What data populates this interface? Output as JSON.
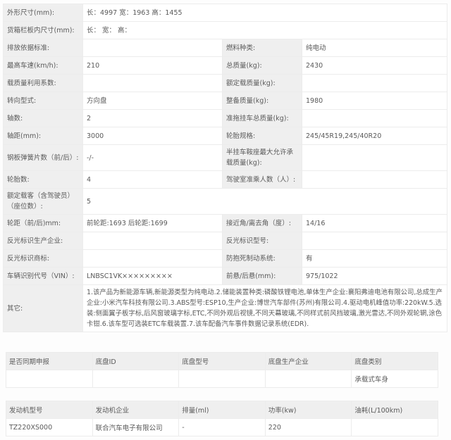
{
  "spec": {
    "dimensions": {
      "label": "外形尺寸(mm):",
      "value": "长：4997 宽：1963 高：1455"
    },
    "cargo_dims": {
      "label": "货箱栏板内尺寸(mm):",
      "value": "长：  宽：  高："
    },
    "emission_std": {
      "label": "排放依据标准:",
      "value": ""
    },
    "fuel_type": {
      "label": "燃料种类:",
      "value": "纯电动"
    },
    "max_speed": {
      "label": "最高车速(km/h):",
      "value": "210"
    },
    "total_mass": {
      "label": "总质量(kg):",
      "value": "2430"
    },
    "load_util": {
      "label": "载质量利用系数:",
      "value": ""
    },
    "rated_load": {
      "label": "额定载质量(kg):",
      "value": ""
    },
    "steering": {
      "label": "转向型式:",
      "value": "方向盘"
    },
    "curb_mass": {
      "label": "整备质量(kg):",
      "value": "1980"
    },
    "axles": {
      "label": "轴数:",
      "value": "2"
    },
    "trailer_mass": {
      "label": "准拖挂车总质量(kg):",
      "value": ""
    },
    "wheelbase": {
      "label": "轴距(mm):",
      "value": "3000"
    },
    "tyre_spec": {
      "label": "轮胎规格:",
      "value": "245/45R19,245/40R20"
    },
    "leaf_springs": {
      "label": "钢板弹簧片数（前/后）:",
      "value": "-/-"
    },
    "saddle_load": {
      "label": "半挂车鞍座最大允许承载质量(kg):",
      "value": ""
    },
    "tyres": {
      "label": "轮胎数:",
      "value": "4"
    },
    "cab_passengers": {
      "label": "驾驶室准乘人数（人）:",
      "value": ""
    },
    "seats": {
      "label": "额定载客（含驾驶员）（座位数）:",
      "value": "5"
    },
    "track": {
      "label": "轮距（前/后)mm:",
      "value": "前轮距:1693 后轮距:1699"
    },
    "approach_angle": {
      "label": "接近角/离去角（度）:",
      "value": "14/16"
    },
    "reflector_maker": {
      "label": "反光标识生产企业:",
      "value": ""
    },
    "reflector_model": {
      "label": "反光标识型号:",
      "value": ""
    },
    "reflector_brand": {
      "label": "反光标识商标:",
      "value": ""
    },
    "abs": {
      "label": "防抱死制动系统:",
      "value": "有"
    },
    "vin": {
      "label": "车辆识别代号（VIN）:",
      "value": "LNBSC1VK×××××××××"
    },
    "overhang": {
      "label": "前悬/后悬(mm):",
      "value": "975/1022"
    },
    "other": {
      "label": "其它:",
      "value": "1.该产品为新能源车辆,新能源类型为纯电动.2.储能装置种类:磷酸铁锂电池,单体生产企业:襄阳弗迪电池有限公司,总成生产企业:小米汽车科技有限公司.3.ABS型号:ESP10,生产企业:博世汽车部件(苏州)有限公司.4.驱动电机峰值功率:220kW.5.选装:侧面翼子板字标,后风窗玻璃字标,ETC,不同外观后视镜,不同天幕玻璃,不同样式前风挡玻璃,激光雷达,不同外观轮辋,涂色卡钳.6.该车型可选装ETC车载装置.7.该车配备汽车事件数据记录系统(EDR)."
    }
  },
  "chassis": {
    "headers": [
      "是否同期申报",
      "底盘ID",
      "底盘型号",
      "底盘生产企业",
      "底盘类别"
    ],
    "rows": [
      [
        "",
        "",
        "",
        "",
        "承载式车身"
      ]
    ]
  },
  "engine": {
    "headers": [
      "发动机型号",
      "发动机企业",
      "排量(ml)",
      "功率(kw)",
      "油耗(L/100km)"
    ],
    "rows": [
      [
        "TZ220XS000",
        "联合汽车电子有限公司",
        "-",
        "220",
        ""
      ]
    ]
  }
}
